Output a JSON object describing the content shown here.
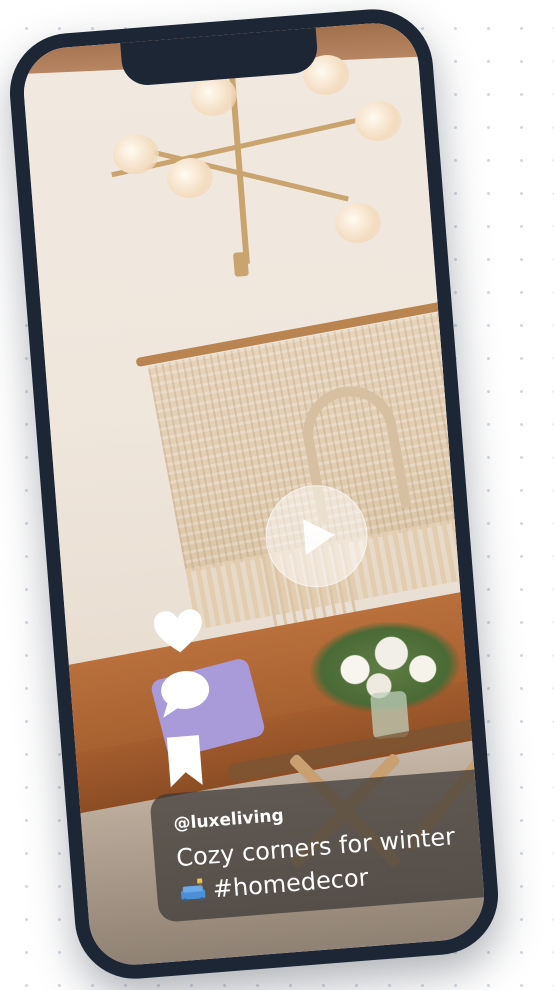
{
  "post": {
    "username": "@luxeliving",
    "caption_line1": "Cozy corners for winter",
    "caption_hashtag": "#homedecor",
    "caption_emoji": "couch-and-lamp-emoji"
  },
  "actions": {
    "like_icon": "heart-icon",
    "comment_icon": "speech-bubble-icon",
    "save_icon": "bookmark-icon"
  },
  "player": {
    "state": "paused",
    "play_icon": "play-icon"
  },
  "colors": {
    "phone_frame": "#1c2635",
    "overlay": "#ffffff",
    "caption_card": "#3c3734",
    "accent_leather": "#b9703d"
  }
}
